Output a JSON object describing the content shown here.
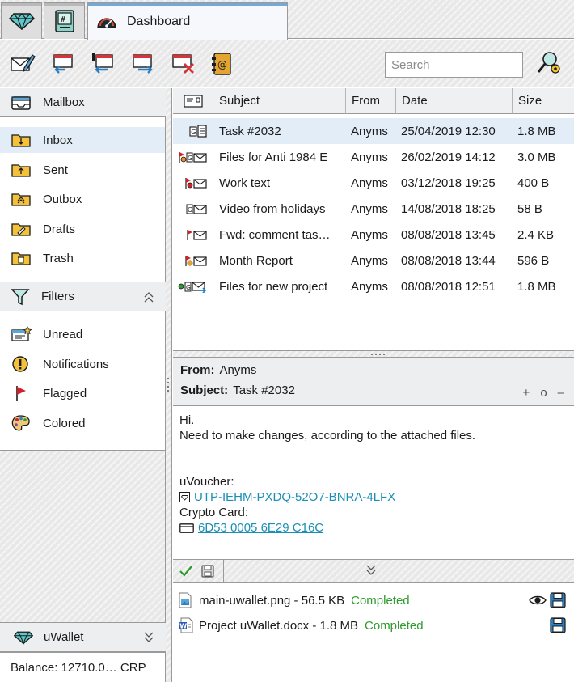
{
  "tabs": {
    "wallet_icon": "diamond-icon",
    "terminal_icon": "terminal-icon",
    "dashboard": {
      "icon": "speedometer-icon",
      "label": "Dashboard"
    }
  },
  "toolbar": {
    "buttons": [
      "compose-icon",
      "reply-icon",
      "reply-all-icon",
      "forward-icon",
      "delete-icon",
      "address-book-icon"
    ],
    "search_placeholder": "Search",
    "search_value": "",
    "advanced_search_icon": "advanced-search-icon"
  },
  "sidebar": {
    "mailbox": {
      "title": "Mailbox",
      "items": [
        {
          "label": "Inbox",
          "icon": "inbox-folder-icon",
          "selected": true
        },
        {
          "label": "Sent",
          "icon": "sent-folder-icon"
        },
        {
          "label": "Outbox",
          "icon": "outbox-folder-icon"
        },
        {
          "label": "Drafts",
          "icon": "drafts-folder-icon"
        },
        {
          "label": "Trash",
          "icon": "trash-folder-icon"
        }
      ]
    },
    "filters": {
      "title": "Filters",
      "items": [
        {
          "label": "Unread",
          "icon": "unread-icon"
        },
        {
          "label": "Notifications",
          "icon": "notification-icon"
        },
        {
          "label": "Flagged",
          "icon": "flag-icon"
        },
        {
          "label": "Colored",
          "icon": "palette-icon"
        }
      ]
    },
    "wallet": {
      "title": "uWallet",
      "balance": "Balance: 12710.0… CRP"
    }
  },
  "message_list": {
    "columns": [
      "Subject",
      "From",
      "Date",
      "Size"
    ],
    "rows": [
      {
        "subject": "Task #2032",
        "from": "Anyms",
        "date": "25/04/2019 12:30",
        "size": "1.8 MB",
        "selected": true
      },
      {
        "subject": "Files for Anti 1984 E",
        "from": "Anyms",
        "date": "26/02/2019 14:12",
        "size": "3.0 MB"
      },
      {
        "subject": "Work text",
        "from": "Anyms",
        "date": "03/12/2018 19:25",
        "size": "400 B"
      },
      {
        "subject": "Video from holidays",
        "from": "Anyms",
        "date": "14/08/2018 18:25",
        "size": "58 B"
      },
      {
        "subject": "Fwd: comment tas…",
        "from": "Anyms",
        "date": "08/08/2018 13:45",
        "size": "2.4 KB"
      },
      {
        "subject": "Month Report",
        "from": "Anyms",
        "date": "08/08/2018 13:44",
        "size": "596 B"
      },
      {
        "subject": "Files for new project",
        "from": "Anyms",
        "date": "08/08/2018 12:51",
        "size": "1.8 MB"
      }
    ]
  },
  "message": {
    "from_label": "From:",
    "from": "Anyms",
    "subject_label": "Subject:",
    "subject": "Task #2032",
    "zoom": [
      "+",
      "o",
      "–"
    ],
    "body_line1": "Hi.",
    "body_line2": "Need to make changes, according to the attached files.",
    "voucher_label": "uVoucher:",
    "voucher_code": "UTP-IEHM-PXDQ-52O7-BNRA-4LFX",
    "card_label": "Crypto Card:",
    "card_number": "6D53 0005 6E29 C16C"
  },
  "attachments": [
    {
      "name": "main-uwallet.png - 56.5 KB",
      "status": "Completed",
      "icon": "image-file-icon"
    },
    {
      "name": "Project uWallet.docx - 1.8 MB",
      "status": "Completed",
      "icon": "word-file-icon"
    }
  ],
  "colors": {
    "accent": "#1a8fb5",
    "selected": "#e3edf7",
    "completed": "#2e9a2e",
    "flag": "#d0202a"
  }
}
